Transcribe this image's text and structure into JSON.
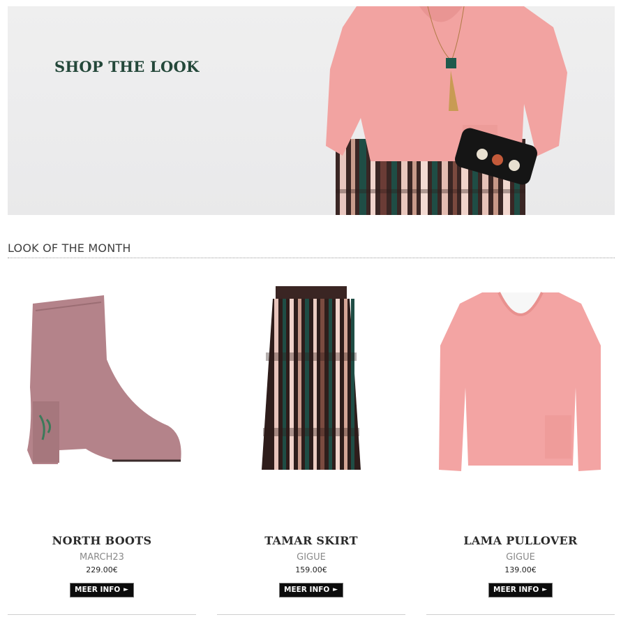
{
  "hero": {
    "title": "SHOP THE LOOK",
    "title_color": "#24483a"
  },
  "section": {
    "title": "LOOK OF THE MONTH"
  },
  "products": [
    {
      "name": "NORTH BOOTS",
      "brand": "MARCH23",
      "price": "229.00€",
      "button": "MEER INFO",
      "arrow": "►",
      "image_icon": "velvet-ankle-boot"
    },
    {
      "name": "TAMAR SKIRT",
      "brand": "GIGUE",
      "price": "159.00€",
      "button": "MEER INFO",
      "arrow": "►",
      "image_icon": "pleated-striped-skirt"
    },
    {
      "name": "LAMA PULLOVER",
      "brand": "GIGUE",
      "price": "139.00€",
      "button": "MEER INFO",
      "arrow": "►",
      "image_icon": "pink-knit-pullover"
    }
  ],
  "colors": {
    "button_bg": "#0c0c0c",
    "button_text": "#ffffff",
    "heading_text": "#404040",
    "brand_text": "#8a8a8a"
  }
}
